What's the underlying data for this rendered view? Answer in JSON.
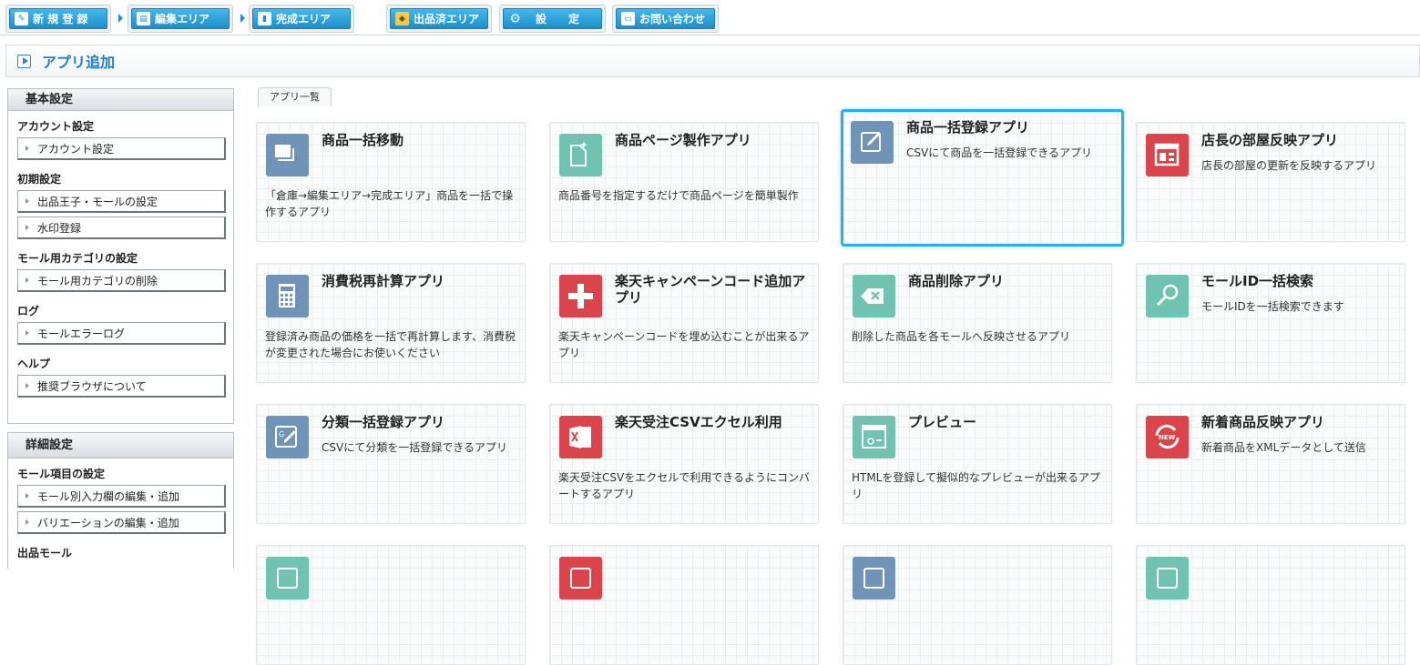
{
  "top_tabs": [
    {
      "label": "新 規 登 録",
      "icon": "edit-icon"
    },
    {
      "label": "編集エリア",
      "icon": "window-icon"
    },
    {
      "label": "完成エリア",
      "icon": "bar-chart-icon"
    },
    {
      "label": "出品済エリア",
      "icon": "box-icon"
    },
    {
      "label": "設　　定",
      "icon": "gear-icon"
    },
    {
      "label": "お問い合わせ",
      "icon": "chat-icon"
    }
  ],
  "page_title": "アプリ追加",
  "sidebar": {
    "basic": {
      "header": "基本設定",
      "groups": [
        {
          "label": "アカウント設定",
          "items": [
            "アカウント設定"
          ]
        },
        {
          "label": "初期設定",
          "items": [
            "出品王子・モールの設定",
            "水印登録"
          ]
        },
        {
          "label": "モール用カテゴリの設定",
          "items": [
            "モール用カテゴリの削除"
          ]
        },
        {
          "label": "ログ",
          "items": [
            "モールエラーログ"
          ]
        },
        {
          "label": "ヘルプ",
          "items": [
            "推奨ブラウザについて"
          ]
        }
      ]
    },
    "detail": {
      "header": "詳細設定",
      "groups": [
        {
          "label": "モール項目の設定",
          "items": [
            "モール別入力欄の編集・追加",
            "バリエーションの編集・追加"
          ]
        },
        {
          "label": "出品モール",
          "items": []
        }
      ]
    }
  },
  "app_list_tab": "アプリ一覧",
  "apps": [
    {
      "title": "商品一括移動",
      "desc": "「倉庫→編集エリア→完成エリア」商品を一括で操作するアプリ",
      "icon": "move-icon",
      "color": "#6f94b8",
      "desc_pos": "bottom",
      "selected": false
    },
    {
      "title": "商品ページ製作アプリ",
      "desc": "商品番号を指定するだけで商品ページを簡単製作",
      "icon": "new-page-icon",
      "color": "#6fc3b0",
      "desc_pos": "bottom",
      "selected": false
    },
    {
      "title": "商品一括登録アプリ",
      "desc": "CSVにて商品を一括登録できるアプリ",
      "icon": "edit-note-icon",
      "color": "#6f94b8",
      "desc_pos": "side",
      "selected": true
    },
    {
      "title": "店長の部屋反映アプリ",
      "desc": "店長の部屋の更新を反映するアプリ",
      "icon": "layout-icon",
      "color": "#d9454a",
      "desc_pos": "side",
      "selected": false
    },
    {
      "title": "消費税再計算アプリ",
      "desc": "登録済み商品の価格を一括で再計算します、消費税が変更された場合にお使いください",
      "icon": "calculator-icon",
      "color": "#6f94b8",
      "desc_pos": "bottom",
      "selected": false
    },
    {
      "title": "楽天キャンペーンコード追加アプリ",
      "desc": "楽天キャンペーンコードを埋め込むことが出来るアプリ",
      "icon": "plus-icon",
      "color": "#d9454a",
      "desc_pos": "bottom",
      "selected": false
    },
    {
      "title": "商品削除アプリ",
      "desc": "削除した商品を各モールへ反映させるアプリ",
      "icon": "delete-icon",
      "color": "#6fc3b0",
      "desc_pos": "bottom",
      "selected": false
    },
    {
      "title": "モールID一括検索",
      "desc": "モールIDを一括検索できます",
      "icon": "search-icon",
      "color": "#6fc3b0",
      "desc_pos": "side",
      "selected": false
    },
    {
      "title": "分類一括登録アプリ",
      "desc": "CSVにて分類を一括登録できるアプリ",
      "icon": "category-edit-icon",
      "color": "#6f94b8",
      "desc_pos": "side",
      "selected": false
    },
    {
      "title": "楽天受注CSVエクセル利用",
      "desc": "楽天受注CSVをエクセルで利用できるようにコンバートするアプリ",
      "icon": "excel-icon",
      "color": "#d9454a",
      "desc_pos": "bottom",
      "selected": false
    },
    {
      "title": "プレビュー",
      "desc": "HTMLを登録して擬似的なプレビューが出来るアプリ",
      "icon": "preview-icon",
      "color": "#6fc3b0",
      "desc_pos": "bottom",
      "selected": false
    },
    {
      "title": "新着商品反映アプリ",
      "desc": "新着商品をXMLデータとして送信",
      "icon": "new-refresh-icon",
      "color": "#d9454a",
      "desc_pos": "side",
      "selected": false
    },
    {
      "title": "",
      "desc": "",
      "icon": "app-icon",
      "color": "#6fc3b0",
      "desc_pos": "side",
      "selected": false
    },
    {
      "title": "",
      "desc": "",
      "icon": "app-icon",
      "color": "#d9454a",
      "desc_pos": "side",
      "selected": false
    },
    {
      "title": "",
      "desc": "",
      "icon": "app-icon",
      "color": "#6f94b8",
      "desc_pos": "side",
      "selected": false
    },
    {
      "title": "",
      "desc": "",
      "icon": "app-icon",
      "color": "#6fc3b0",
      "desc_pos": "side",
      "selected": false
    }
  ]
}
